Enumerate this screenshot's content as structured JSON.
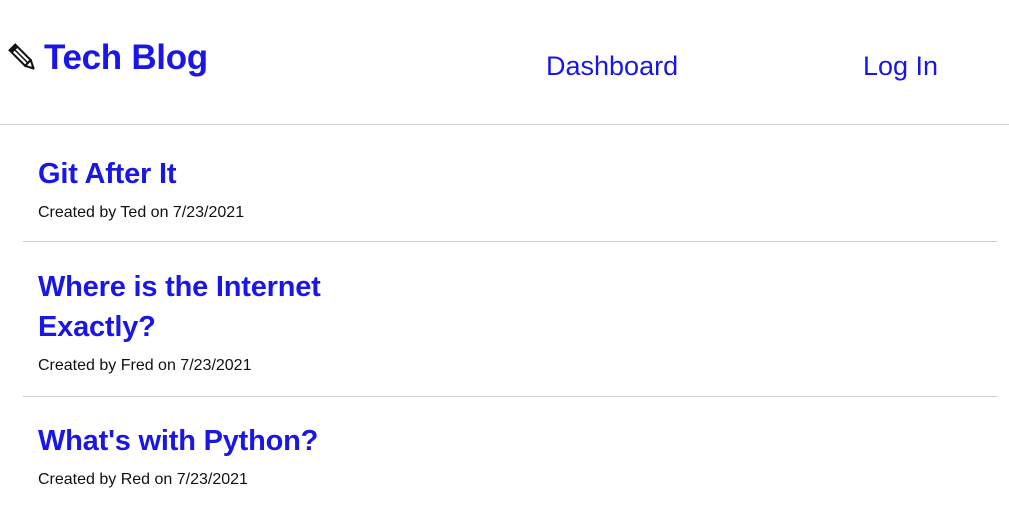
{
  "header": {
    "brand_icon": "pencil-icon",
    "title": "Tech Blog",
    "nav": {
      "dashboard": "Dashboard",
      "login": "Log In"
    }
  },
  "posts": [
    {
      "title": "Git After It",
      "meta": "Created by Ted on 7/23/2021"
    },
    {
      "title": "Where is the Internet Exactly?",
      "meta": "Created by Fred on 7/23/2021"
    },
    {
      "title": "What's with Python?",
      "meta": "Created by Red on 7/23/2021"
    }
  ],
  "colors": {
    "link": "#1a17e6",
    "divider": "#cccccc",
    "text": "#111111"
  }
}
